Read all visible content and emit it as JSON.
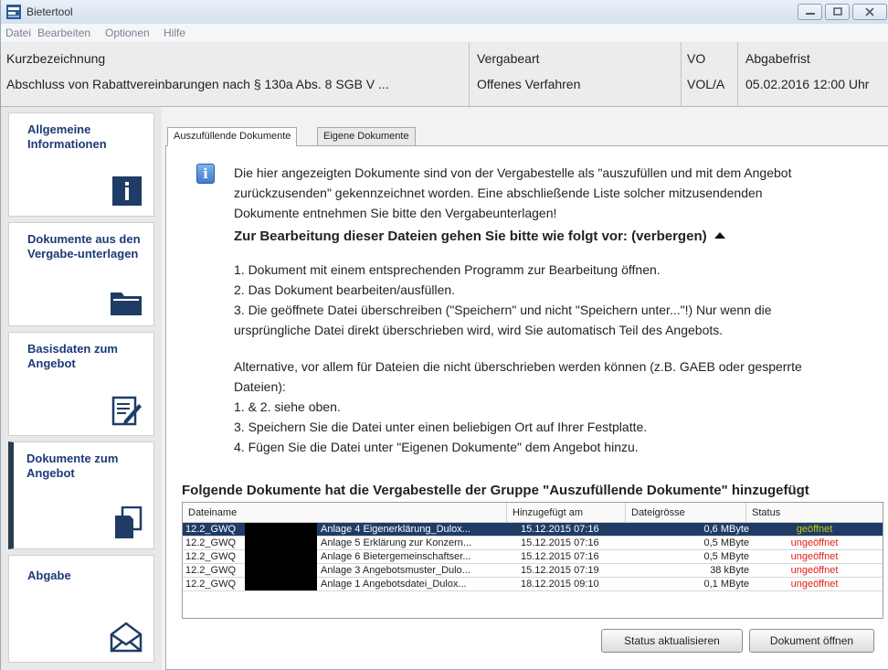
{
  "window": {
    "title": "Bietertool"
  },
  "menu": [
    "Datei",
    "Bearbeiten",
    "Optionen",
    "Hilfe"
  ],
  "header": {
    "kurz_label": "Kurzbezeichnung",
    "kurz_value": "Abschluss von Rabattvereinbarungen nach § 130a Abs. 8 SGB V ...",
    "vergabeart_label": "Vergabeart",
    "vergabeart_value": "Offenes Verfahren",
    "vo_label": "VO",
    "vo_value": "VOL/A",
    "frist_label": "Abgabefrist",
    "frist_value": "05.02.2016 12:00 Uhr"
  },
  "sidebar": {
    "items": [
      {
        "label": "Allgemeine Informationen",
        "icon": "info-icon"
      },
      {
        "label": "Dokumente aus den Vergabe-unterlagen",
        "icon": "folder-icon"
      },
      {
        "label": "Basisdaten zum Angebot",
        "icon": "edit-document-icon"
      },
      {
        "label": "Dokumente zum Angebot",
        "icon": "documents-icon",
        "active": true
      },
      {
        "label": "Abgabe",
        "icon": "envelope-icon"
      }
    ]
  },
  "tabs": [
    {
      "label": "Auszufüllende Dokumente",
      "active": true
    },
    {
      "label": "Eigene Dokumente",
      "active": false
    }
  ],
  "content": {
    "intro1": "Die hier angezeigten Dokumente sind von der Vergabestelle als \"auszufüllen und mit dem Angebot",
    "intro2": "zurückzusenden\" gekennzeichnet worden. Eine abschließende Liste solcher mitzusendenden",
    "intro3": "Dokumente entnehmen Sie bitte den Vergabeunterlagen!",
    "howto_heading": "Zur Bearbeitung dieser Dateien gehen Sie bitte wie folgt vor: (verbergen)",
    "step1": "1. Dokument mit einem entsprechenden Programm zur Bearbeitung öffnen.",
    "step2": "2. Das Dokument bearbeiten/ausfüllen.",
    "step3a": "3. Die geöffnete Datei überschreiben (\"Speichern\" und nicht \"Speichern unter...\"!) Nur wenn die",
    "step3b": "ursprüngliche Datei direkt überschrieben wird, wird Sie automatisch Teil des Angebots.",
    "alt1": "Alternative, vor allem für Dateien die nicht überschrieben werden können (z.B. GAEB oder gesperrte",
    "alt2": "Dateien):",
    "alt3": "1. & 2. siehe oben.",
    "alt4": "3. Speichern Sie die Datei unter einen beliebigen Ort auf Ihrer Festplatte.",
    "alt5": "4. Fügen Sie die Datei unter \"Eigenen Dokumente\" dem Angebot hinzu.",
    "section_heading": "Folgende Dokumente hat die Vergabestelle der Gruppe \"Auszufüllende Dokumente\" hinzugefügt"
  },
  "table": {
    "headers": [
      "Dateiname",
      "Hinzugefügt am",
      "Dateigrösse",
      "Status"
    ],
    "rows": [
      {
        "prefix": "12.2_GWQ",
        "name": "Anlage 4 Eigenerklärung_Dulox...",
        "date": "15.12.2015 07:16",
        "size": "0,6 MByte",
        "status": "geöffnet",
        "selected": true
      },
      {
        "prefix": "12.2_GWQ",
        "name": "Anlage 5 Erklärung zur Konzern...",
        "date": "15.12.2015 07:16",
        "size": "0,5 MByte",
        "status": "ungeöffnet"
      },
      {
        "prefix": "12.2_GWQ",
        "name": "Anlage 6 Bietergemeinschaftser...",
        "date": "15.12.2015 07:16",
        "size": "0,5 MByte",
        "status": "ungeöffnet"
      },
      {
        "prefix": "12.2_GWQ",
        "name": "Anlage 3 Angebotsmuster_Dulo...",
        "date": "15.12.2015 07:19",
        "size": "38 kByte",
        "status": "ungeöffnet"
      },
      {
        "prefix": "12.2_GWQ",
        "name": "Anlage 1 Angebotsdatei_Dulox...",
        "date": "18.12.2015 09:10",
        "size": "0,1 MByte",
        "status": "ungeöffnet"
      }
    ]
  },
  "buttons": {
    "refresh": "Status aktualisieren",
    "open": "Dokument öffnen"
  },
  "colors": {
    "status_opened": "#a8a800",
    "status_unopened": "#e0201a",
    "nav_text": "#1b3a78",
    "selection": "#1f3c66"
  }
}
